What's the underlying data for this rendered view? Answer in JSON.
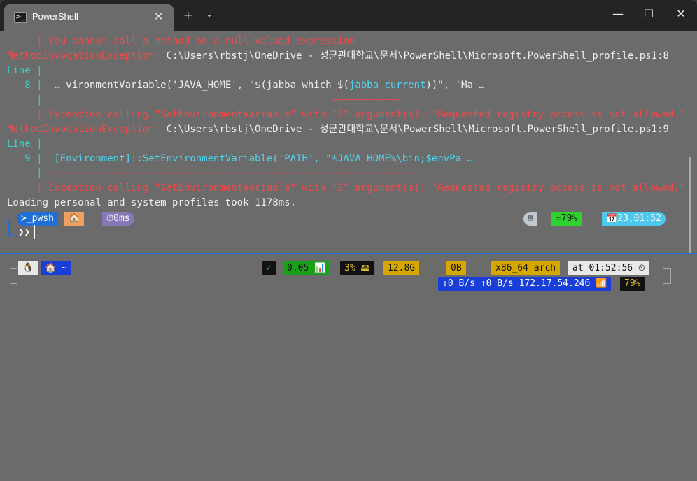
{
  "titlebar": {
    "tab_title": "PowerShell",
    "tab_icon": "powershell-icon",
    "close_tab": "✕",
    "new_tab": "+",
    "dropdown": "⌄",
    "minimize": "—",
    "maximize": "☐",
    "close": "✕"
  },
  "output": {
    "l1": "     | You cannot call a method on a null-valued expression.",
    "l2_err": "MethodInvocationException:",
    "l2_path": " C:\\Users\\rbstj\\OneDrive - 성균관대학교\\문서\\PowerShell\\Microsoft.PowerShell_profile.ps1:8",
    "l3": "Line |",
    "l4_num": "   8 |",
    "l4_code_a": "  … vironmentVariable('JAVA_HOME', \"$(jabba which $(",
    "l4_code_b": "jabba current",
    "l4_code_c": "))\", 'Ma …",
    "l5": "     |",
    "l5_squig": "~~~~~~~~~~~~~",
    "l6": "     | Exception calling \"SetEnvironmentVariable\" with \"3\" argument(s): \"Requested registry access is not allowed.\"",
    "l7_err": "MethodInvocationException:",
    "l7_path": " C:\\Users\\rbstj\\OneDrive - 성균관대학교\\문서\\PowerShell\\Microsoft.PowerShell_profile.ps1:9",
    "l8": "Line |",
    "l9_num": "   9 |",
    "l9_code": "  [Environment]::SetEnvironmentVariable('PATH', \"%JAVA_HOME%\\bin;$envPa …",
    "l10": "     |",
    "l10_squig": "~~~~~~~~~~~~~~~~~~~~~~~~~~~~~~~~~~~~~~~~~~~~~~~~~~~~~~~~~~~~~~~~~~~~~~~",
    "l11": "     | Exception calling \"SetEnvironmentVariable\" with \"3\" argument(s): \"Requested registry access is not allowed.\"",
    "l12": "Loading personal and system profiles took 1178ms."
  },
  "prompt1": {
    "shell": "≻_pwsh",
    "folder": "🏠",
    "exec_time": "⏱0ms",
    "os": "⊞",
    "battery": "▭79%",
    "datetime": "📅23,01:52"
  },
  "prompt2": {
    "os": "🐧",
    "home": "🏠 ~",
    "check": "✓",
    "load": "0.05 📊",
    "disk": "3% 🖴",
    "mem": "12.8G",
    "swap": "0B",
    "arch": "x86_64 arch",
    "time": "at 01:52:56 ⏲",
    "net": "↓0 B/s ↑0 B/s 172.17.54.246 📶",
    "battery": "79%"
  },
  "colors": {
    "accent_blue": "#1f6fd6",
    "error_red": "#f04a4a",
    "cyan": "#3fd0c9"
  }
}
